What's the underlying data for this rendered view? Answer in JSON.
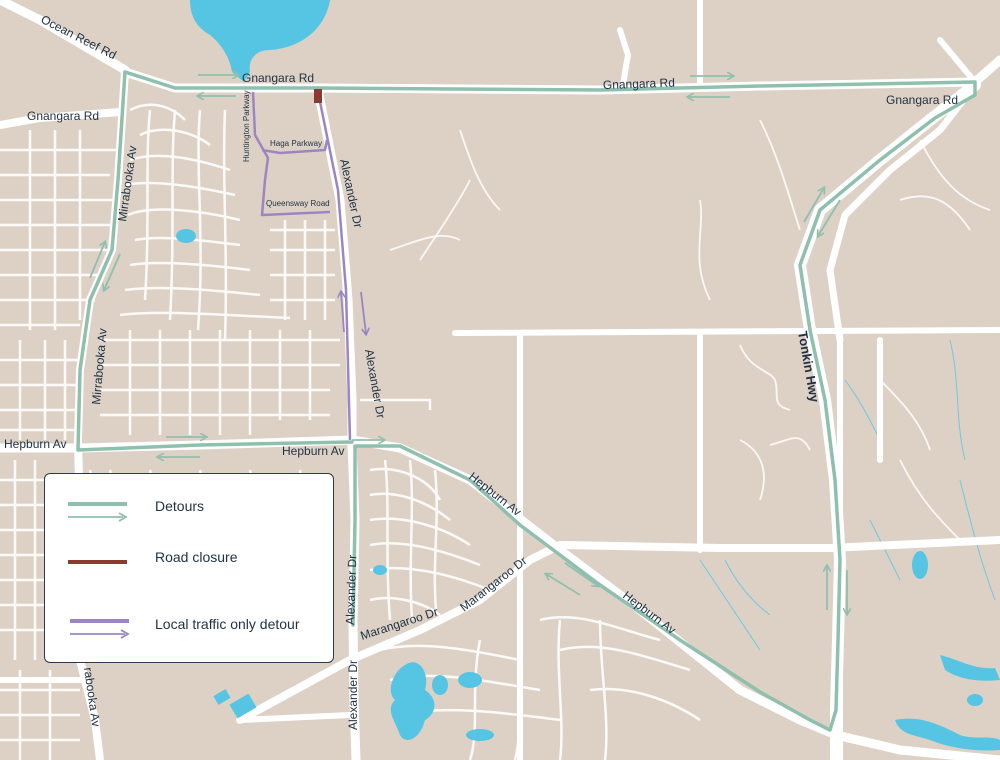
{
  "map": {
    "colors": {
      "land": "#ddd1c6",
      "road": "#ffffff",
      "water": "#55c5e3",
      "detour": "#8fbfad",
      "closure": "#8b3a30",
      "local": "#9b86c2",
      "label": "#1f3144"
    },
    "labels": {
      "ocean_reef_rd": "Ocean Reef Rd",
      "gnangara_rd_1": "Gnangara Rd",
      "gnangara_rd_2": "Gnangara Rd",
      "gnangara_rd_3": "Gnangara Rd",
      "gnangara_rd_4": "Gnangara Rd",
      "mirrabooka_av_1": "Mirrabooka Av",
      "mirrabooka_av_2": "Mirrabooka Av",
      "mirrabooka_av_3": "rabooka Av",
      "huntington_parkway": "Huntington Parkway",
      "haga_parkway": "Haga Parkway",
      "queensway_road": "Queensway Road",
      "alexander_dr_1": "Alexander Dr",
      "alexander_dr_2": "Alexander Dr",
      "alexander_dr_3": "Alexander Dr",
      "alexander_dr_4": "Alexander Dr",
      "tonkin_hwy": "Tonkin Hwy",
      "hepburn_av_1": "Hepburn Av",
      "hepburn_av_2": "Hepburn Av",
      "hepburn_av_3": "Hepburn Av",
      "hepburn_av_4": "Hepburn Av",
      "marangaroo_dr_1": "Marangaroo Dr",
      "marangaroo_dr_2": "Marangaroo Dr"
    },
    "icons": {
      "arrow": "detour-direction-arrow-icon",
      "closure": "road-closure-marker"
    }
  },
  "legend": {
    "detours": "Detours",
    "road_closure": "Road closure",
    "local_traffic": "Local traffic only detour"
  }
}
